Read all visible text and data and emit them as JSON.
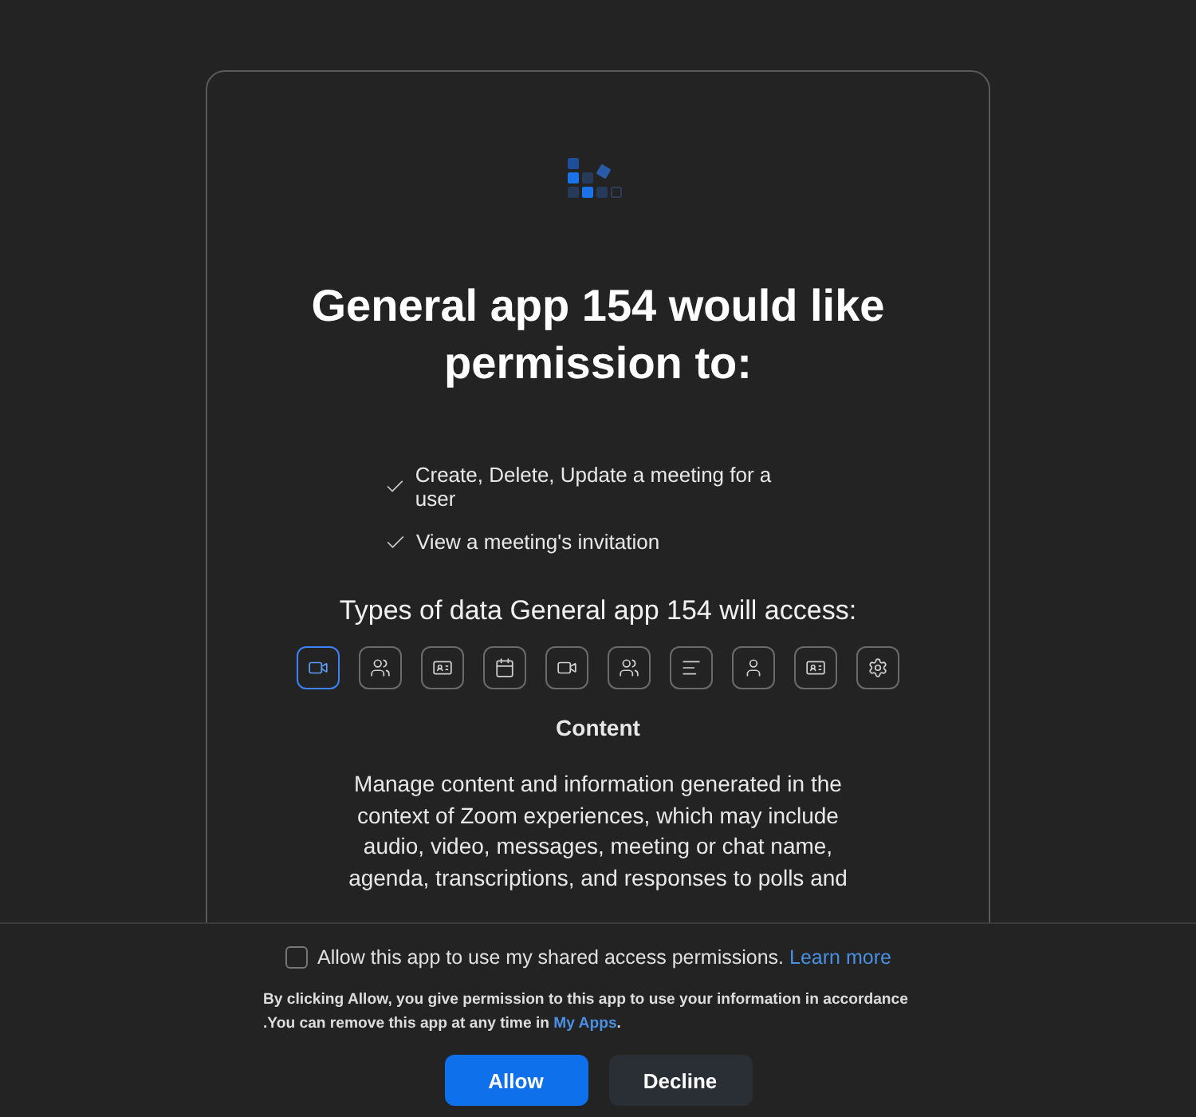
{
  "title": "General app 154 would like permission to:",
  "permissions": [
    "Create, Delete, Update a meeting for a user",
    "View a meeting's invitation"
  ],
  "data_heading": "Types of data General app 154 will access:",
  "data_types": [
    {
      "kind": "video",
      "selected": true
    },
    {
      "kind": "people",
      "selected": false
    },
    {
      "kind": "card",
      "selected": false
    },
    {
      "kind": "calendar",
      "selected": false
    },
    {
      "kind": "video",
      "selected": false
    },
    {
      "kind": "people",
      "selected": false
    },
    {
      "kind": "lines",
      "selected": false
    },
    {
      "kind": "person",
      "selected": false
    },
    {
      "kind": "card",
      "selected": false
    },
    {
      "kind": "gear",
      "selected": false
    }
  ],
  "detail": {
    "title": "Content",
    "description": "Manage content and information generated in the context of Zoom experiences, which may include audio, video, messages, meeting or chat name, agenda, transcriptions, and responses to polls and"
  },
  "footer": {
    "consent": {
      "checked": false,
      "label": "Allow this app to use my shared access permissions.",
      "link": "Learn more"
    },
    "notice": "By clicking Allow, you give permission to this app to use your information in accordance",
    "notice_2": ".You can remove this app at any time in",
    "notice_link": "My Apps",
    "notice_end": ".",
    "buttons": [
      {
        "label": "Allow",
        "kind": "primary"
      },
      {
        "label": "Decline",
        "kind": "secondary"
      }
    ]
  }
}
